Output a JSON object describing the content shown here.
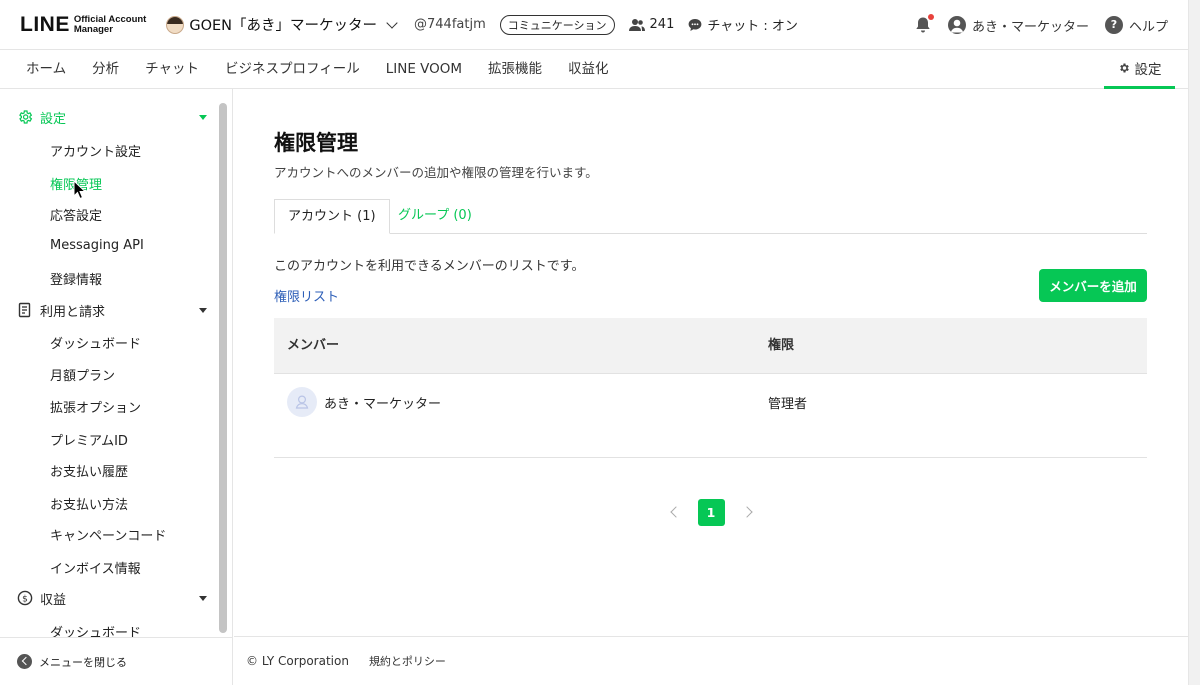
{
  "header": {
    "logo_main": "LINE",
    "logo_sub_1": "Official Account",
    "logo_sub_2": "Manager",
    "account_name": "GOEN「あき」マーケッター",
    "account_id": "@744fatjm",
    "plan_badge": "コミュニケーション",
    "followers": "241",
    "chat_status": "チャット : オン",
    "user_name": "あき・マーケッター",
    "help": "ヘルプ"
  },
  "nav": {
    "items": [
      "ホーム",
      "分析",
      "チャット",
      "ビジネスプロフィール",
      "LINE VOOM",
      "拡張機能",
      "収益化"
    ],
    "settings": "設定"
  },
  "sidebar": {
    "group_settings": "設定",
    "settings_items": [
      "アカウント設定",
      "権限管理",
      "応答設定",
      "Messaging API",
      "登録情報"
    ],
    "group_billing": "利用と請求",
    "billing_items": [
      "ダッシュボード",
      "月額プラン",
      "拡張オプション",
      "プレミアムID",
      "お支払い履歴",
      "お支払い方法",
      "キャンペーンコード",
      "インボイス情報"
    ],
    "group_revenue": "収益",
    "revenue_items": [
      "ダッシュボード"
    ],
    "close_menu": "メニューを閉じる"
  },
  "main": {
    "title": "権限管理",
    "description": "アカウントへのメンバーの追加や権限の管理を行います。",
    "tab_account": "アカウント (1)",
    "tab_group": "グループ (0)",
    "list_description": "このアカウントを利用できるメンバーのリストです。",
    "permission_list_link": "権限リスト",
    "add_member_button": "メンバーを追加",
    "table": {
      "col_member": "メンバー",
      "col_role": "権限",
      "rows": [
        {
          "name": "あき・マーケッター",
          "role": "管理者"
        }
      ]
    },
    "pagination": {
      "current_page": "1"
    }
  },
  "footer": {
    "copyright": "© LY Corporation",
    "policy": "規約とポリシー"
  },
  "colors": {
    "accent": "#06c755",
    "link": "#2e5fb8"
  }
}
